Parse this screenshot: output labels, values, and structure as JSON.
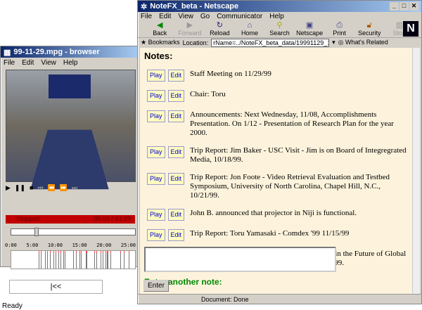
{
  "player": {
    "title": "99-11-29.mpg - browser",
    "menu": [
      "File",
      "Edit",
      "View",
      "Help"
    ],
    "status": "Stopped",
    "time": "05:03 / 41:29",
    "ticks": [
      "0:00",
      "5:00",
      "10:00",
      "15:00",
      "20:00",
      "25:00"
    ],
    "rewind": "|<<",
    "statusbar": "Ready",
    "position_fraction": 0.12
  },
  "browser": {
    "title": "NoteFX_beta - Netscape",
    "menu": [
      "File",
      "Edit",
      "View",
      "Go",
      "Communicator",
      "Help"
    ],
    "toolbar": [
      "Back",
      "Forward",
      "Reload",
      "Home",
      "Search",
      "Netscape",
      "Print",
      "Security",
      "Stop"
    ],
    "bookmarks": "Bookmarks",
    "location_label": "Location:",
    "location": "rName=../NoteFX_beta_data/19991129_110000_13.242.36.122/",
    "related": "What's Related",
    "status": "Document: Done"
  },
  "notes": {
    "heading": "Notes:",
    "play": "Play",
    "edit": "Edit",
    "items": [
      "Staff Meeting on 11/29/99",
      "Chair: Toru",
      "Announcements: Next Wednesday, 11/08, Accomplishments Presentation. On 1/12 - Presentation of Research Plan for the year 2000.",
      "Trip Report: Jim Baker - USC Visit - Jim is on Board of Integregrated Media, 10/18/99.",
      "Trip Report: Jon Foote - Video Retrieval Evaluation and Testbed Symposium, University of North Carolina, Chapel Hill, N.C., 10/21/99.",
      "John B. announced that projector in Niji is functional.",
      "Trip Report: Toru Yamasaki - Comdex '99 11/15/99",
      "Trip Report: Toru Yamasaki - \"Where is Japan in the Future of Global High Tech Business?\" Stanford University, 11/99."
    ],
    "another": "Enter another note:",
    "enter": "Enter"
  }
}
